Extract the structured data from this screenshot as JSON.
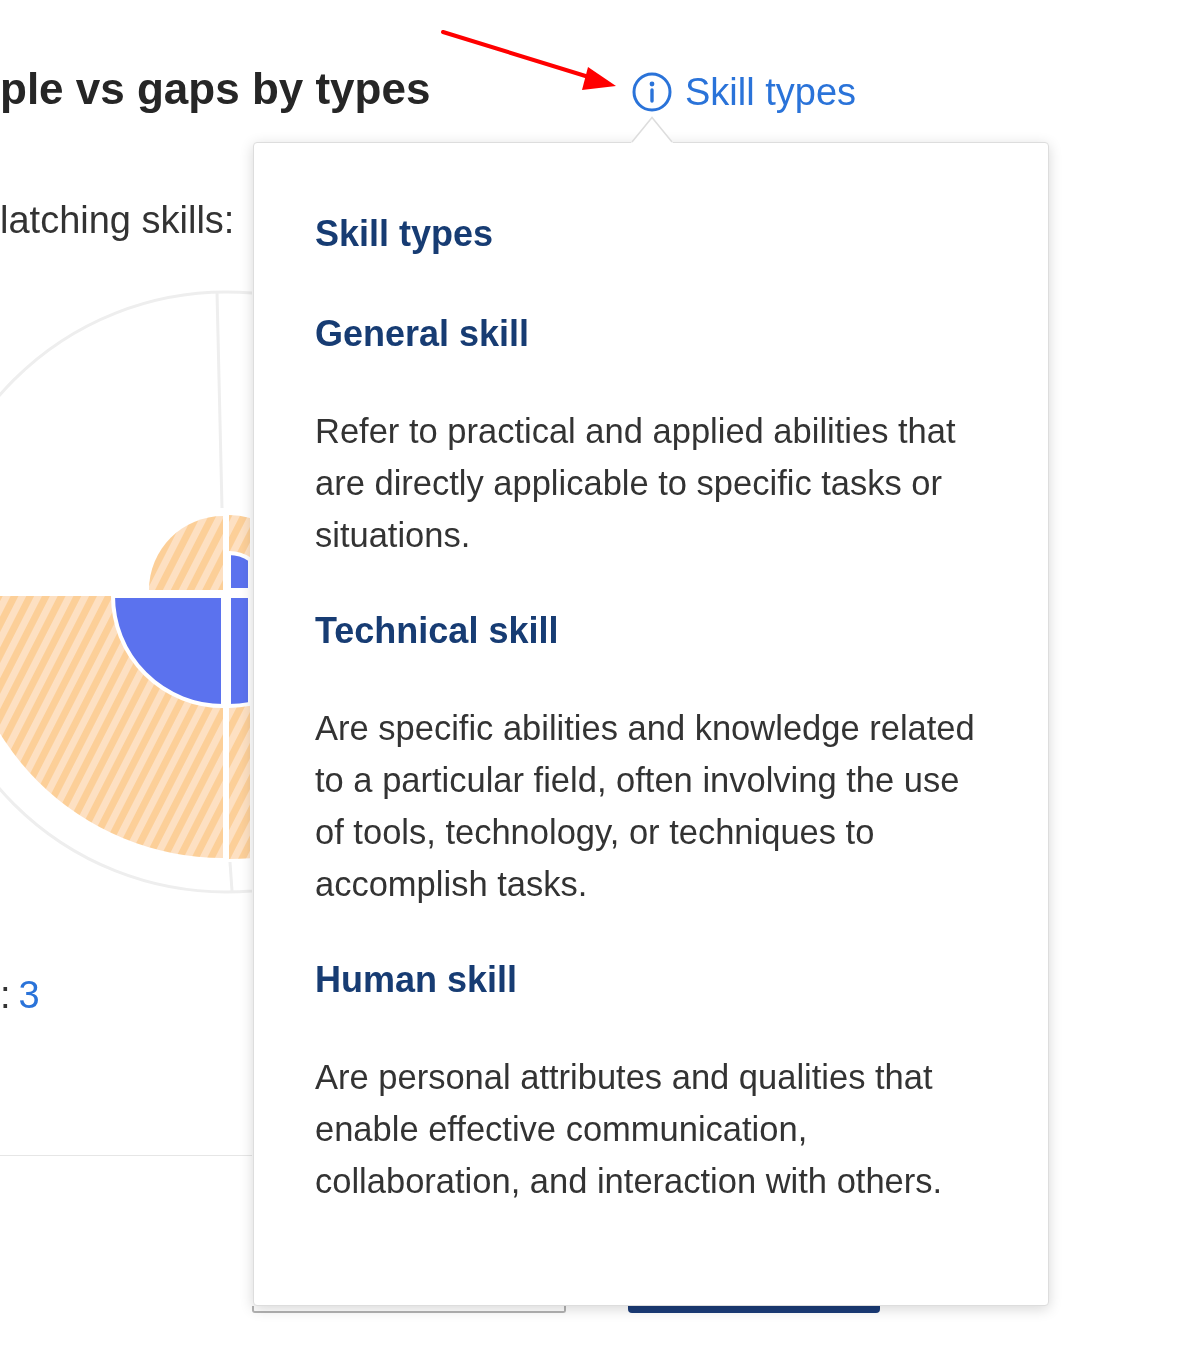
{
  "section": {
    "title": "ple vs gaps by types",
    "info_link": {
      "label": "Skill types"
    },
    "matching_label": "latching skills:",
    "gaps": {
      "label": ":",
      "value": "3"
    }
  },
  "popover": {
    "title": "Skill types",
    "items": [
      {
        "heading": "General skill",
        "description": "Refer to practical and applied abilities that are directly applicable to specific tasks or situations."
      },
      {
        "heading": "Technical skill",
        "description": "Are specific abilities and knowledge related to a particular field, often involving the use of tools, technology, or techniques to accomplish tasks."
      },
      {
        "heading": "Human skill",
        "description": "Are personal attributes and qualities that enable effective communication, collaboration, and interaction with others."
      }
    ]
  }
}
